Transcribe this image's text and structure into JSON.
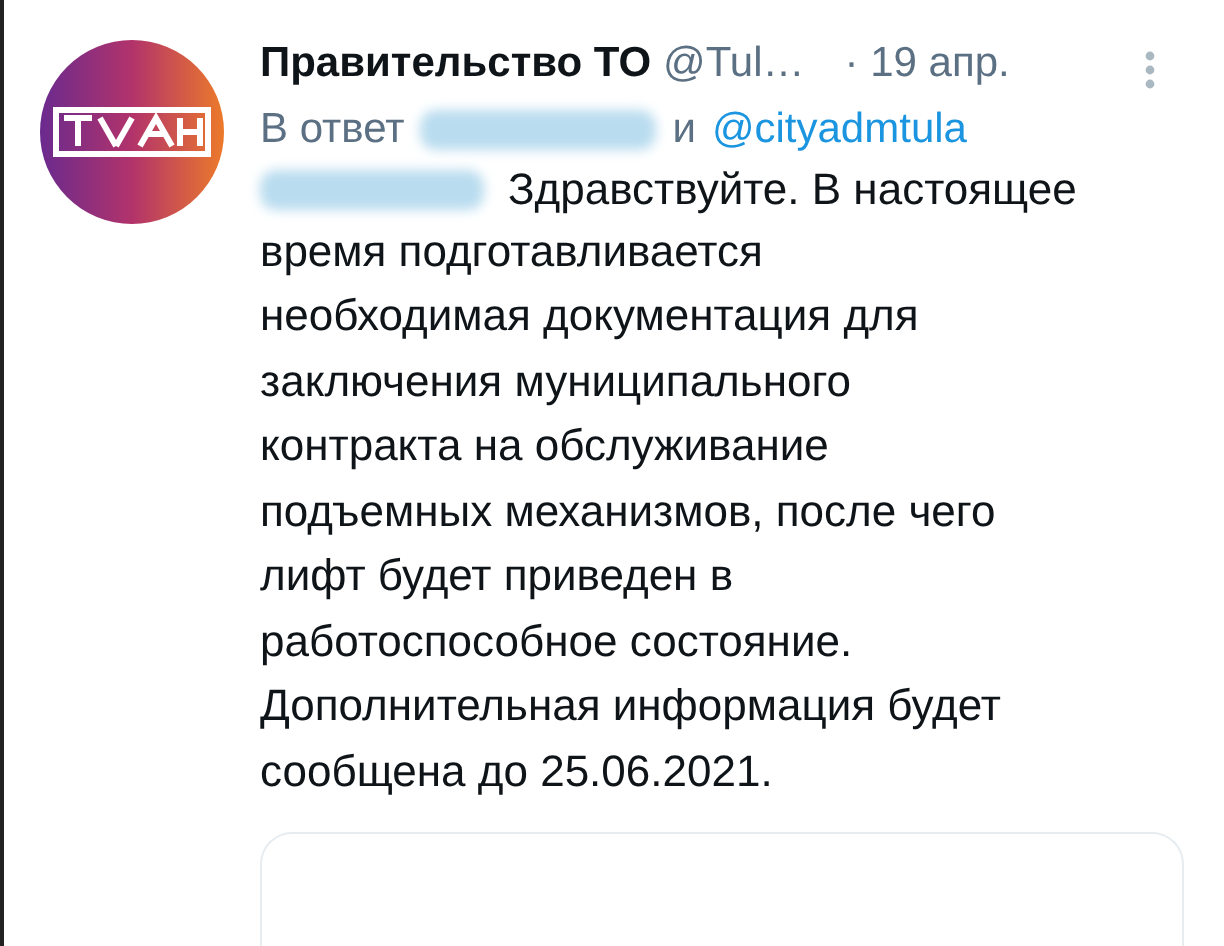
{
  "tweet": {
    "author": "Правительство ТО",
    "handle": "@Tul…",
    "time": "· 19 апр.",
    "reply_to": {
      "prefix": "В ответ",
      "joiner": "и",
      "mention": "@cityadmtula"
    },
    "first_line": "Здравствуйте. В настоящее",
    "body_lines": [
      "время подготавливается",
      "необходимая документация для",
      "заключения муниципального",
      "контракта на обслуживание",
      "подъемных механизмов, после чего",
      "лифт будет приведен в",
      "работоспособное состояние.",
      "Дополнительная информация будет",
      "сообщена до 25.06.2021."
    ]
  }
}
